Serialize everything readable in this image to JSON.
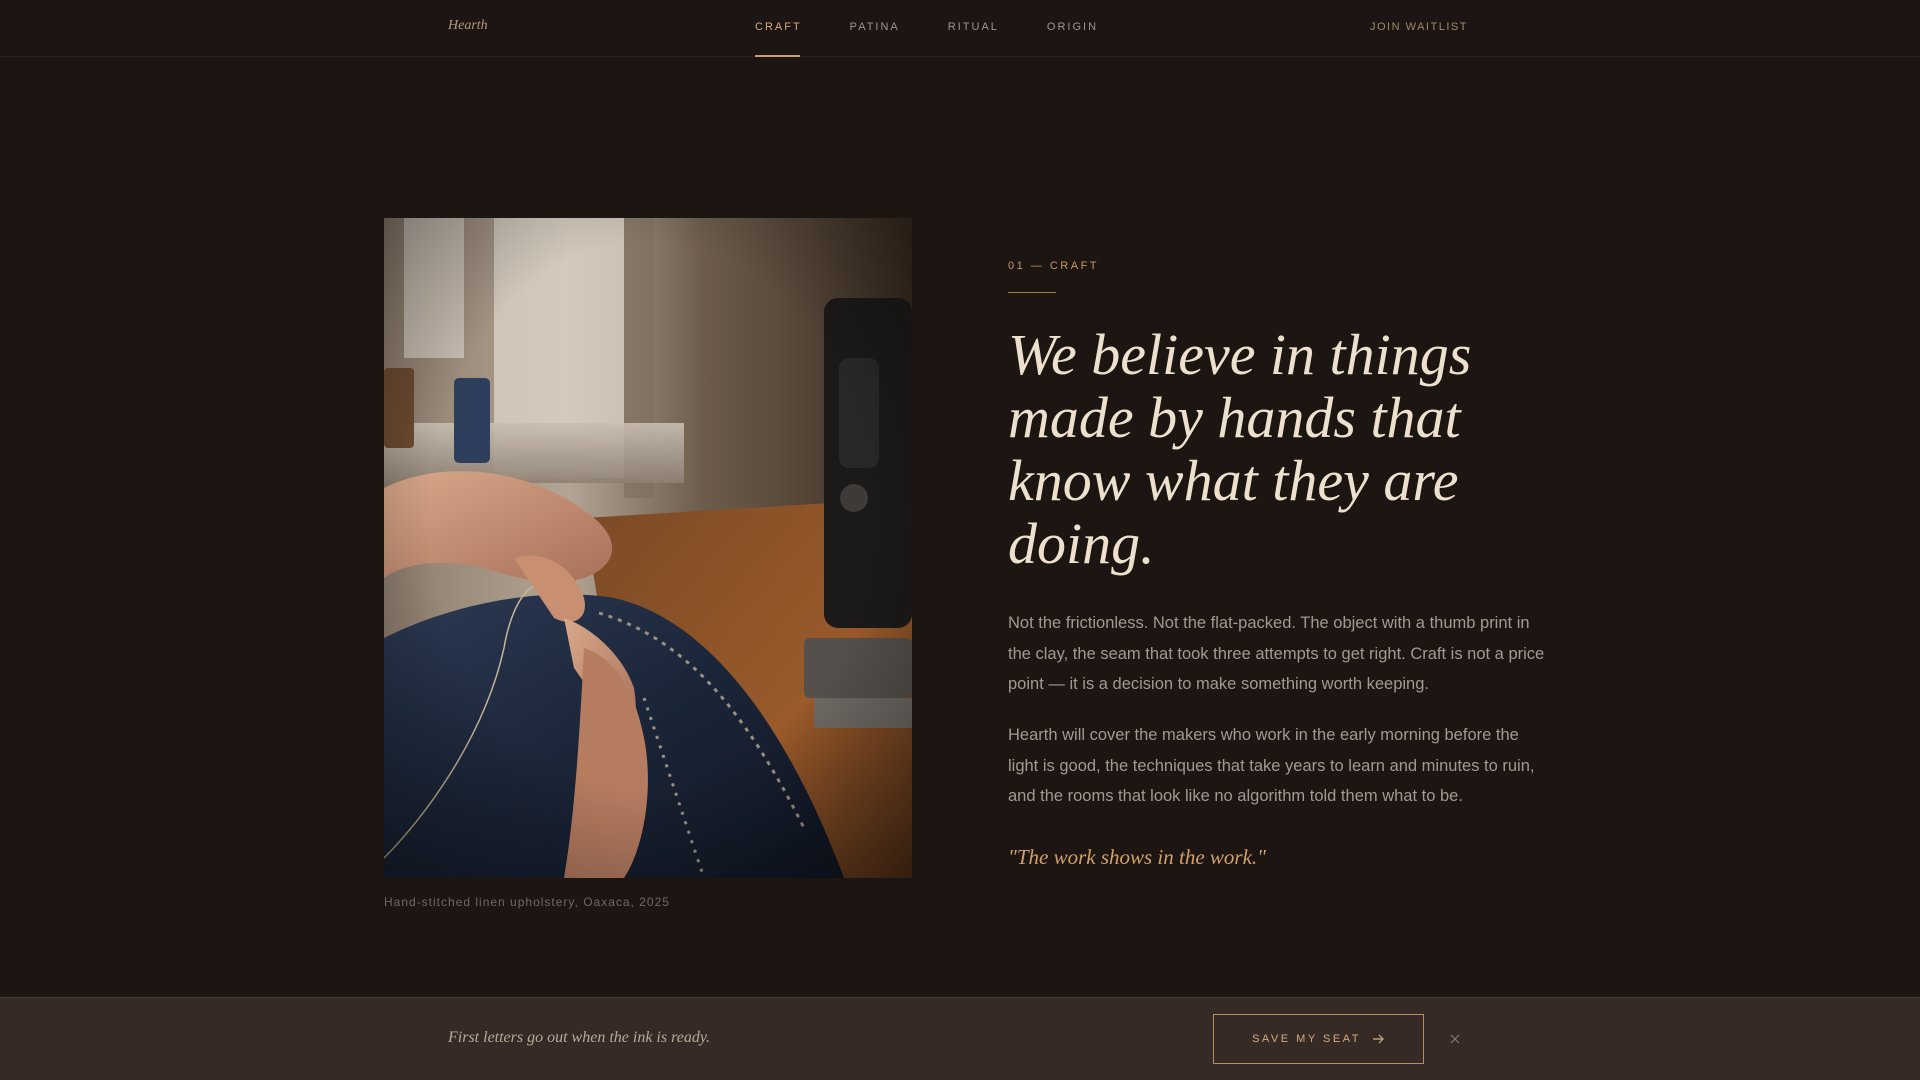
{
  "nav": {
    "brand": "Hearth",
    "links": [
      {
        "label": "CRAFT",
        "active": true
      },
      {
        "label": "PATINA",
        "active": false
      },
      {
        "label": "RITUAL",
        "active": false
      },
      {
        "label": "ORIGIN",
        "active": false
      }
    ],
    "cta": "JOIN WAITLIST"
  },
  "feature": {
    "image_caption": "Hand-stitched linen upholstery, Oaxaca, 2025",
    "eyebrow": "01 — CRAFT",
    "headline": "We believe in things made by hands that know what they are doing.",
    "paragraphs": [
      "Not the frictionless. Not the flat-packed. The object with a thumb print in the clay, the seam that took three attempts to get right. Craft is not a price point — it is a decision to make something worth keeping.",
      "Hearth will cover the makers who work in the early morning before the light is good, the techniques that take years to learn and minutes to ruin, and the rooms that look like no algorithm told them what to be."
    ],
    "quote": "\"The work shows in the work.\""
  },
  "banner": {
    "text": "First letters go out when the ink is ready.",
    "button_label": "SAVE MY SEAT"
  },
  "colors": {
    "background": "#1c1512",
    "accent": "#c9a070",
    "headline": "#ede0cc",
    "body_text": "#a29990",
    "banner": "#352a26"
  },
  "icons": [
    "arrow-right-icon",
    "close-icon"
  ]
}
